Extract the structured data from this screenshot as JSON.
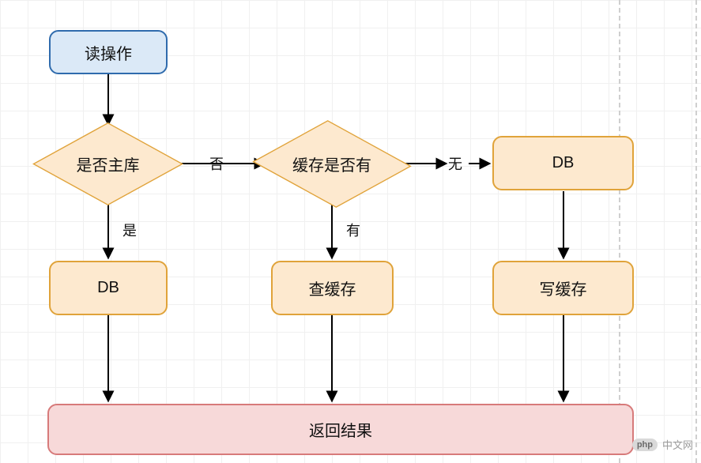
{
  "nodes": {
    "start": {
      "label": "读操作"
    },
    "d1": {
      "label": "是否主库"
    },
    "d2": {
      "label": "缓存是否有"
    },
    "db_right": {
      "label": "DB"
    },
    "db_left": {
      "label": "DB"
    },
    "cache_read": {
      "label": "查缓存"
    },
    "cache_write": {
      "label": "写缓存"
    },
    "result": {
      "label": "返回结果"
    }
  },
  "edges": {
    "d1_right": "否",
    "d1_down": "是",
    "d2_right": "无",
    "d2_down": "有"
  },
  "watermark": {
    "badge": "php",
    "text": "中文网"
  }
}
